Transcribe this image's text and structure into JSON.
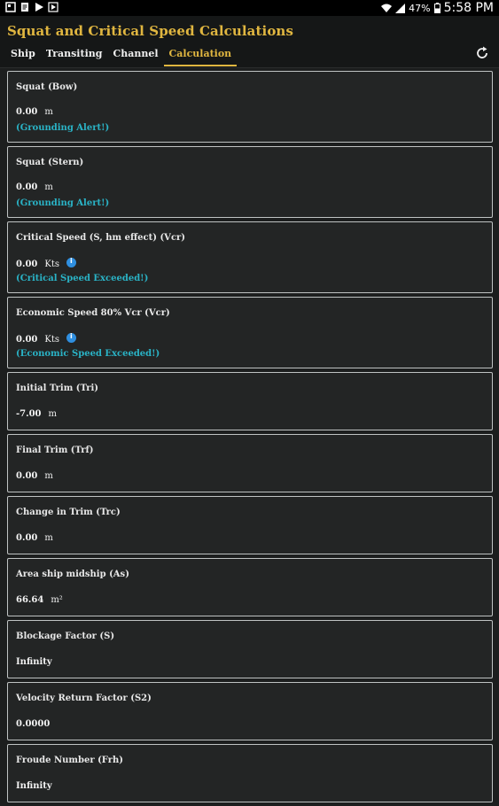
{
  "status_bar": {
    "battery": "47%",
    "time": "5:58 PM",
    "icons": [
      "notification-icon",
      "document-icon",
      "play-icon",
      "play-icon-2",
      "wifi-icon",
      "signal-icon",
      "battery-icon"
    ]
  },
  "app": {
    "title": "Squat and Critical Speed Calculations",
    "accent_color": "#e0b640",
    "alert_color": "#2ab3c6"
  },
  "tabs": [
    {
      "label": "Ship",
      "active": false
    },
    {
      "label": "Transiting",
      "active": false
    },
    {
      "label": "Channel",
      "active": false
    },
    {
      "label": "Calculation",
      "active": true
    }
  ],
  "cards": [
    {
      "title": "Squat (Bow)",
      "value": "0.00",
      "unit": "m",
      "alert": "(Grounding Alert!)"
    },
    {
      "title": "Squat (Stern)",
      "value": "0.00",
      "unit": "m",
      "alert": "(Grounding Alert!)"
    },
    {
      "title": "Critical Speed (S, hm effect) (Vcr)",
      "value": "0.00",
      "unit": "Kts",
      "alert": "(Critical Speed Exceeded!)"
    },
    {
      "title": "Economic Speed 80% Vcr (Vcr)",
      "value": "0.00",
      "unit": "Kts",
      "alert": "(Economic Speed Exceeded!)"
    },
    {
      "title": "Initial Trim (Tri)",
      "value": "-7.00",
      "unit": "m"
    },
    {
      "title": "Final Trim (Trf)",
      "value": "0.00",
      "unit": "m"
    },
    {
      "title": "Change in Trim (Trc)",
      "value": "0.00",
      "unit": "m"
    },
    {
      "title": "Area ship midship (As)",
      "value": "66.64",
      "unit": "m²"
    },
    {
      "title": "Blockage Factor (S)",
      "value": "Infinity",
      "unit": ""
    },
    {
      "title": "Velocity Return Factor (S2)",
      "value": "0.0000",
      "unit": ""
    },
    {
      "title": "Froude Number (Frh)",
      "value": "Infinity",
      "unit": ""
    }
  ]
}
